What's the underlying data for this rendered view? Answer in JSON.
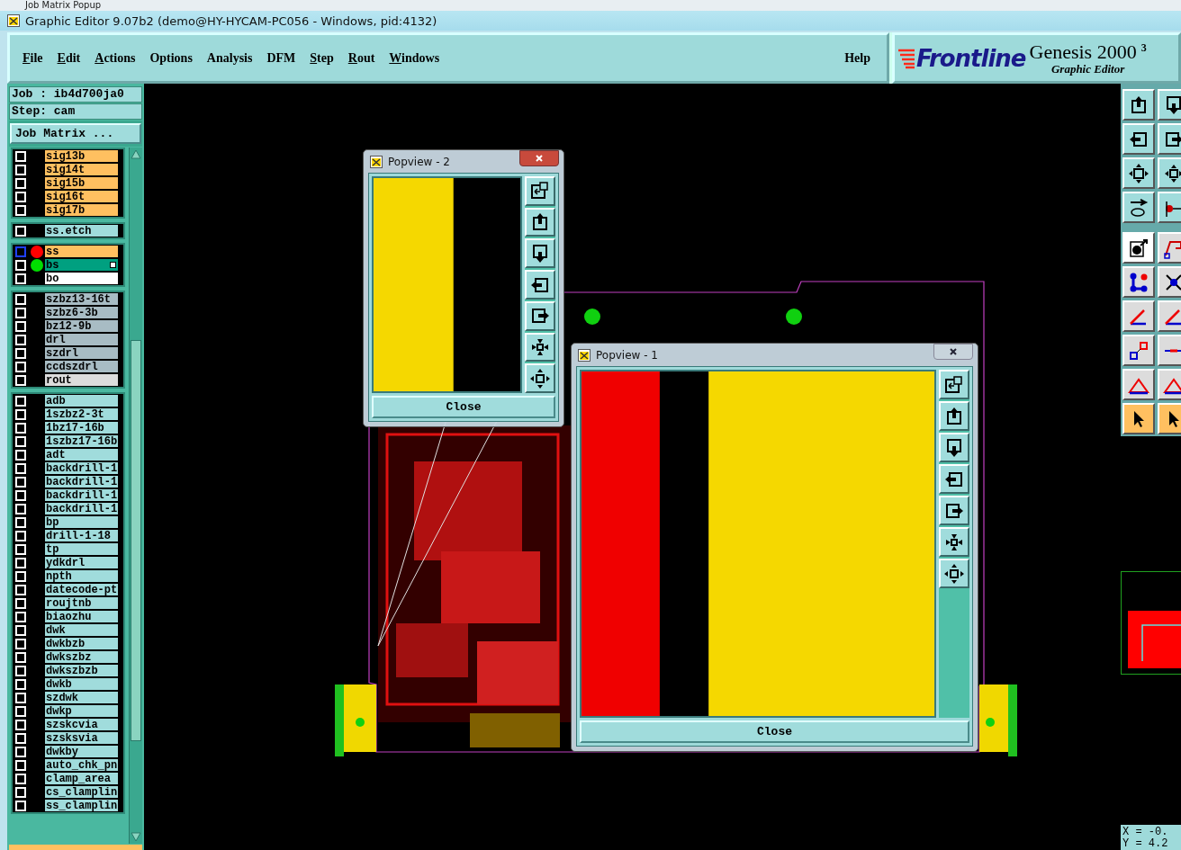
{
  "background_window": {
    "title": "Job Matrix Popup"
  },
  "window": {
    "title": "Graphic Editor 9.07b2 (demo@HY-HYCAM-PC056 - Windows, pid:4132)"
  },
  "menu": [
    {
      "label": "File",
      "underlined": true
    },
    {
      "label": "Edit",
      "underlined": true
    },
    {
      "label": "Actions",
      "underlined": true
    },
    {
      "label": "Options",
      "underlined": false
    },
    {
      "label": "Analysis",
      "underlined": false
    },
    {
      "label": "DFM",
      "underlined": false
    },
    {
      "label": "Step",
      "underlined": true
    },
    {
      "label": "Rout",
      "underlined": true
    },
    {
      "label": "Windows",
      "underlined": true
    }
  ],
  "help": "Help",
  "brand": {
    "logo": "Frontline",
    "product": "Genesis 2000",
    "version": "3",
    "subtitle": "Graphic Editor"
  },
  "job": "Job : ib4d700ja0",
  "step": "Step: cam",
  "job_matrix_button": "Job Matrix ...",
  "layer_groups": [
    [
      {
        "name": "sig13b",
        "kind": "signal",
        "checked": false,
        "selected": false
      },
      {
        "name": "sig14t",
        "kind": "signal",
        "checked": false,
        "selected": false
      },
      {
        "name": "sig15b",
        "kind": "signal",
        "checked": false,
        "selected": false
      },
      {
        "name": "sig16t",
        "kind": "signal",
        "checked": false,
        "selected": false
      },
      {
        "name": "sig17b",
        "kind": "signal",
        "checked": false,
        "selected": false
      }
    ],
    [
      {
        "name": "ss.etch",
        "kind": "misc",
        "checked": false,
        "selected": false
      }
    ],
    [
      {
        "name": "ss",
        "kind": "signal",
        "checked": false,
        "selected": true,
        "color": "#ff0000"
      },
      {
        "name": "bs",
        "kind": "work",
        "checked": false,
        "selected": false,
        "color": "#00dd00",
        "marked": true
      },
      {
        "name": "bo",
        "kind": "board",
        "checked": false,
        "selected": false
      }
    ],
    [
      {
        "name": "szbz13-16t",
        "kind": "drill",
        "checked": false,
        "selected": false
      },
      {
        "name": "szbz6-3b",
        "kind": "drill",
        "checked": false,
        "selected": false
      },
      {
        "name": "bz12-9b",
        "kind": "drill",
        "checked": false,
        "selected": false
      },
      {
        "name": "drl",
        "kind": "drill",
        "checked": false,
        "selected": false
      },
      {
        "name": "szdrl",
        "kind": "drill",
        "checked": false,
        "selected": false
      },
      {
        "name": "ccdszdrl",
        "kind": "drill",
        "checked": false,
        "selected": false
      },
      {
        "name": "rout",
        "kind": "rout",
        "checked": false,
        "selected": false
      }
    ],
    [
      {
        "name": "adb",
        "kind": "misc",
        "checked": false,
        "selected": false
      },
      {
        "name": "1szbz2-3t",
        "kind": "misc",
        "checked": false,
        "selected": false
      },
      {
        "name": "1bz17-16b",
        "kind": "misc",
        "checked": false,
        "selected": false
      },
      {
        "name": "1szbz17-16b",
        "kind": "misc",
        "checked": false,
        "selected": false
      },
      {
        "name": "adt",
        "kind": "misc",
        "checked": false,
        "selected": false
      },
      {
        "name": "backdrill-1",
        "kind": "misc",
        "checked": false,
        "selected": false
      },
      {
        "name": "backdrill-1",
        "kind": "misc",
        "checked": false,
        "selected": false
      },
      {
        "name": "backdrill-1",
        "kind": "misc",
        "checked": false,
        "selected": false
      },
      {
        "name": "backdrill-1",
        "kind": "misc",
        "checked": false,
        "selected": false
      },
      {
        "name": "bp",
        "kind": "misc",
        "checked": false,
        "selected": false
      },
      {
        "name": "drill-1-18",
        "kind": "misc",
        "checked": false,
        "selected": false
      },
      {
        "name": "tp",
        "kind": "misc",
        "checked": false,
        "selected": false
      },
      {
        "name": "ydkdrl",
        "kind": "misc",
        "checked": false,
        "selected": false
      },
      {
        "name": "npth",
        "kind": "misc",
        "checked": false,
        "selected": false
      },
      {
        "name": "datecode-pt",
        "kind": "misc",
        "checked": false,
        "selected": false
      },
      {
        "name": "roujtnb",
        "kind": "misc",
        "checked": false,
        "selected": false
      },
      {
        "name": "biaozhu",
        "kind": "misc",
        "checked": false,
        "selected": false
      },
      {
        "name": "dwk",
        "kind": "misc",
        "checked": false,
        "selected": false
      },
      {
        "name": "dwkbzb",
        "kind": "misc",
        "checked": false,
        "selected": false
      },
      {
        "name": "dwkszbz",
        "kind": "misc",
        "checked": false,
        "selected": false
      },
      {
        "name": "dwkszbzb",
        "kind": "misc",
        "checked": false,
        "selected": false
      },
      {
        "name": "dwkb",
        "kind": "misc",
        "checked": false,
        "selected": false
      },
      {
        "name": "szdwk",
        "kind": "misc",
        "checked": false,
        "selected": false
      },
      {
        "name": "dwkp",
        "kind": "misc",
        "checked": false,
        "selected": false
      },
      {
        "name": "szskcvia",
        "kind": "misc",
        "checked": false,
        "selected": false
      },
      {
        "name": "szsksvia",
        "kind": "misc",
        "checked": false,
        "selected": false
      },
      {
        "name": "dwkby",
        "kind": "misc",
        "checked": false,
        "selected": false
      },
      {
        "name": "auto_chk_pn",
        "kind": "misc",
        "checked": false,
        "selected": false
      },
      {
        "name": "clamp_area",
        "kind": "misc",
        "checked": false,
        "selected": false
      },
      {
        "name": "cs_clamplin",
        "kind": "misc",
        "checked": false,
        "selected": false
      },
      {
        "name": "ss_clamplin",
        "kind": "misc",
        "checked": false,
        "selected": false
      }
    ]
  ],
  "tool_groups": [
    [
      {
        "kind": "up",
        "color": "#a0dcdc"
      },
      {
        "kind": "down",
        "color": "#a0dcdc"
      },
      {
        "kind": "left",
        "color": "#a0dcdc"
      },
      {
        "kind": "right",
        "color": "#a0dcdc"
      },
      {
        "kind": "fit",
        "color": "#a0dcdc"
      },
      {
        "kind": "center",
        "color": "#a0dcdc"
      },
      {
        "kind": "tools",
        "color": "#a0dcdc"
      },
      {
        "kind": "snap",
        "color": "#a0dcdc"
      }
    ],
    [
      {
        "kind": "feature",
        "color": "#ffffff"
      },
      {
        "kind": "polygon",
        "color": "#dcdcdc"
      },
      {
        "kind": "nodes",
        "color": "#dcdcdc"
      },
      {
        "kind": "cross",
        "color": "#dcdcdc"
      },
      {
        "kind": "angle",
        "color": "#dcdcdc"
      },
      {
        "kind": "angle",
        "color": "#dcdcdc"
      },
      {
        "kind": "squares",
        "color": "#dcdcdc"
      },
      {
        "kind": "line",
        "color": "#dcdcdc"
      },
      {
        "kind": "triangle",
        "color": "#dcdcdc"
      },
      {
        "kind": "triangle",
        "color": "#dcdcdc"
      },
      {
        "kind": "pointer",
        "color": "#ffc060"
      },
      {
        "kind": "pointer",
        "color": "#ffc060"
      }
    ]
  ],
  "coordinates": [
    "X = -0.",
    "Y = 4.2"
  ],
  "popviews": [
    {
      "title": "Popview - 2",
      "close_button": "Close",
      "buttons": [
        {
          "kind": "copy"
        },
        {
          "kind": "up"
        },
        {
          "kind": "down"
        },
        {
          "kind": "left"
        },
        {
          "kind": "right"
        },
        {
          "kind": "in"
        },
        {
          "kind": "out"
        }
      ]
    },
    {
      "title": "Popview - 1",
      "close_button": "Close",
      "buttons": [
        {
          "kind": "copy"
        },
        {
          "kind": "up"
        },
        {
          "kind": "down"
        },
        {
          "kind": "left"
        },
        {
          "kind": "right"
        },
        {
          "kind": "in"
        },
        {
          "kind": "out"
        }
      ]
    }
  ]
}
